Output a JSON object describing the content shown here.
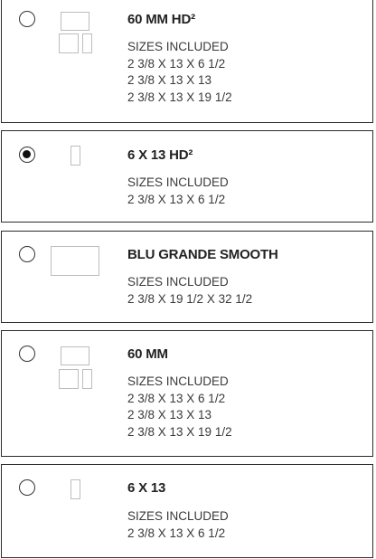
{
  "options": [
    {
      "title": "60 MM HD²",
      "sizes_label": "SIZES INCLUDED",
      "sizes": [
        "2 3/8 X 13 X 6 1/2",
        "2 3/8 X 13 X 13",
        "2 3/8 X 13 X 19 1/2"
      ],
      "selected": false
    },
    {
      "title": "6 X 13 HD²",
      "sizes_label": "SIZES INCLUDED",
      "sizes": [
        "2 3/8 X 13 X 6 1/2"
      ],
      "selected": true
    },
    {
      "title": "BLU GRANDE SMOOTH",
      "sizes_label": "SIZES INCLUDED",
      "sizes": [
        "2 3/8 X 19 1/2 X 32 1/2"
      ],
      "selected": false
    },
    {
      "title": "60 MM",
      "sizes_label": "SIZES INCLUDED",
      "sizes": [
        "2 3/8 X 13 X 6 1/2",
        "2 3/8 X 13 X 13",
        "2 3/8 X 13 X 19 1/2"
      ],
      "selected": false
    },
    {
      "title": "6 X 13",
      "sizes_label": "SIZES INCLUDED",
      "sizes": [
        "2 3/8 X 13 X 6 1/2"
      ],
      "selected": false
    }
  ]
}
